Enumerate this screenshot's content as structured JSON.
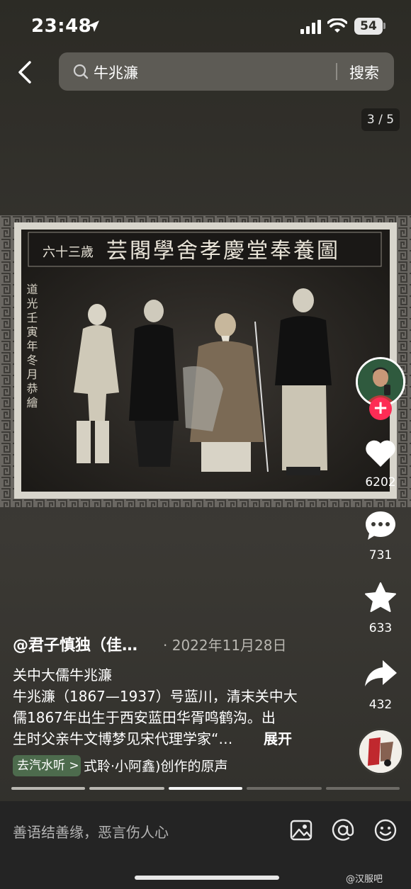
{
  "status": {
    "time": "23:48",
    "battery": "54"
  },
  "search": {
    "query": "牛兆濂",
    "button": "搜索"
  },
  "page_counter": "3 / 5",
  "photo": {
    "banner_main": "芸閣學舍孝慶堂奉養圖",
    "banner_side": "六十三歲",
    "side_inscription": "道光壬寅年冬月恭繪"
  },
  "actions": {
    "likes": "6202",
    "comments": "731",
    "favorites": "633",
    "shares": "432"
  },
  "post": {
    "author": "@君子慎独（佳…",
    "date": "· 2022年11月28日",
    "lines": [
      "关中大儒牛兆濂",
      "牛兆濂（1867—1937）号蓝川，清末关中大",
      "儒1867年出生于西安蓝田华胥鸣鹤沟。出",
      "生时父亲牛文博梦见宋代理学家“…"
    ],
    "expand": "展开",
    "music_chip": "去汽水听 >",
    "music": "式聆·小阿鑫)创作的原声"
  },
  "comment_bar": {
    "placeholder": "善语结善缘，恶言伤人心"
  },
  "watermark": "@汉服吧"
}
